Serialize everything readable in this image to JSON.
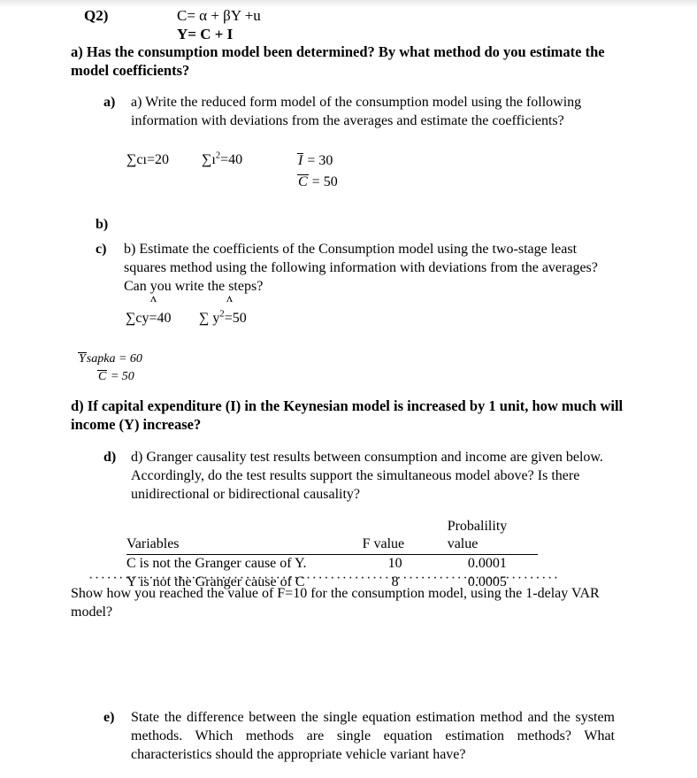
{
  "document": {
    "question_label": "Q2)",
    "equations": {
      "consumption": "C= α + βY +u",
      "income": "Y= C + I"
    },
    "bold_questions": {
      "a": "a) Has the consumption model been determined? By what method do you estimate the model coefficients?",
      "d": "d) If capital expenditure (I) in the Keynesian model is increased by 1 unit, how much will income (Y) increase?"
    },
    "items": {
      "a": {
        "marker": "a)",
        "text": "a) Write the reduced form model of the consumption model using the following information with deviations from the averages and estimate the coefficients?"
      },
      "b": {
        "marker": "b)",
        "text": ""
      },
      "c": {
        "marker": "c)",
        "text": "b) Estimate the coefficients of the Consumption model using the two-stage least squares method using the following information with deviations from the averages? Can you write the steps?"
      },
      "d": {
        "marker": "d)",
        "text": "d) Granger causality test results between consumption and income are given below. Accordingly, do the test results support the simultaneous model above? Is there unidirectional or bidirectional causality?"
      },
      "e": {
        "marker": "e)",
        "text_line1": "State the difference between the single equation estimation method and the system",
        "text_line2": "methods. Which methods are single equation estimation methods? What",
        "text_line3": "characteristics should the appropriate vehicle variant have?"
      }
    },
    "sums_row_1": {
      "sum_ci": "∑cı=20",
      "sum_i_sq_prefix": "∑ı",
      "sum_i_sq_exp": "2",
      "sum_i_sq_suffix": "=40"
    },
    "means_row_1": {
      "mean_i_symbol": "I",
      "mean_i_value": "= 30",
      "mean_c_symbol": "C",
      "mean_c_value": "= 50"
    },
    "carets": {
      "left": "ʌ",
      "right": "ʌ"
    },
    "sums_row_2": {
      "sum_cy": "∑cy=40",
      "sum_y_sq_prefix": "∑ y",
      "sum_y_sq_exp": "2",
      "sum_y_sq_suffix": "=50"
    },
    "ysapka": {
      "symbol": "Y",
      "label": "sapka",
      "value": "= 60",
      "mean_c_symbol": "C",
      "mean_c_value": "= 50"
    },
    "granger_table": {
      "headers": [
        "Variables",
        "F value",
        "Probalility value"
      ],
      "rows": [
        [
          "C is not the Granger cause of Y.",
          "10",
          "0.0001"
        ],
        [
          "Y is not the Granger cause of C",
          "8",
          "0.0005"
        ]
      ]
    },
    "dotted_separator": "··················································································································",
    "show_how_text": "Show how you reached the value of F=10 for the consumption model, using the 1-delay VAR model?"
  }
}
